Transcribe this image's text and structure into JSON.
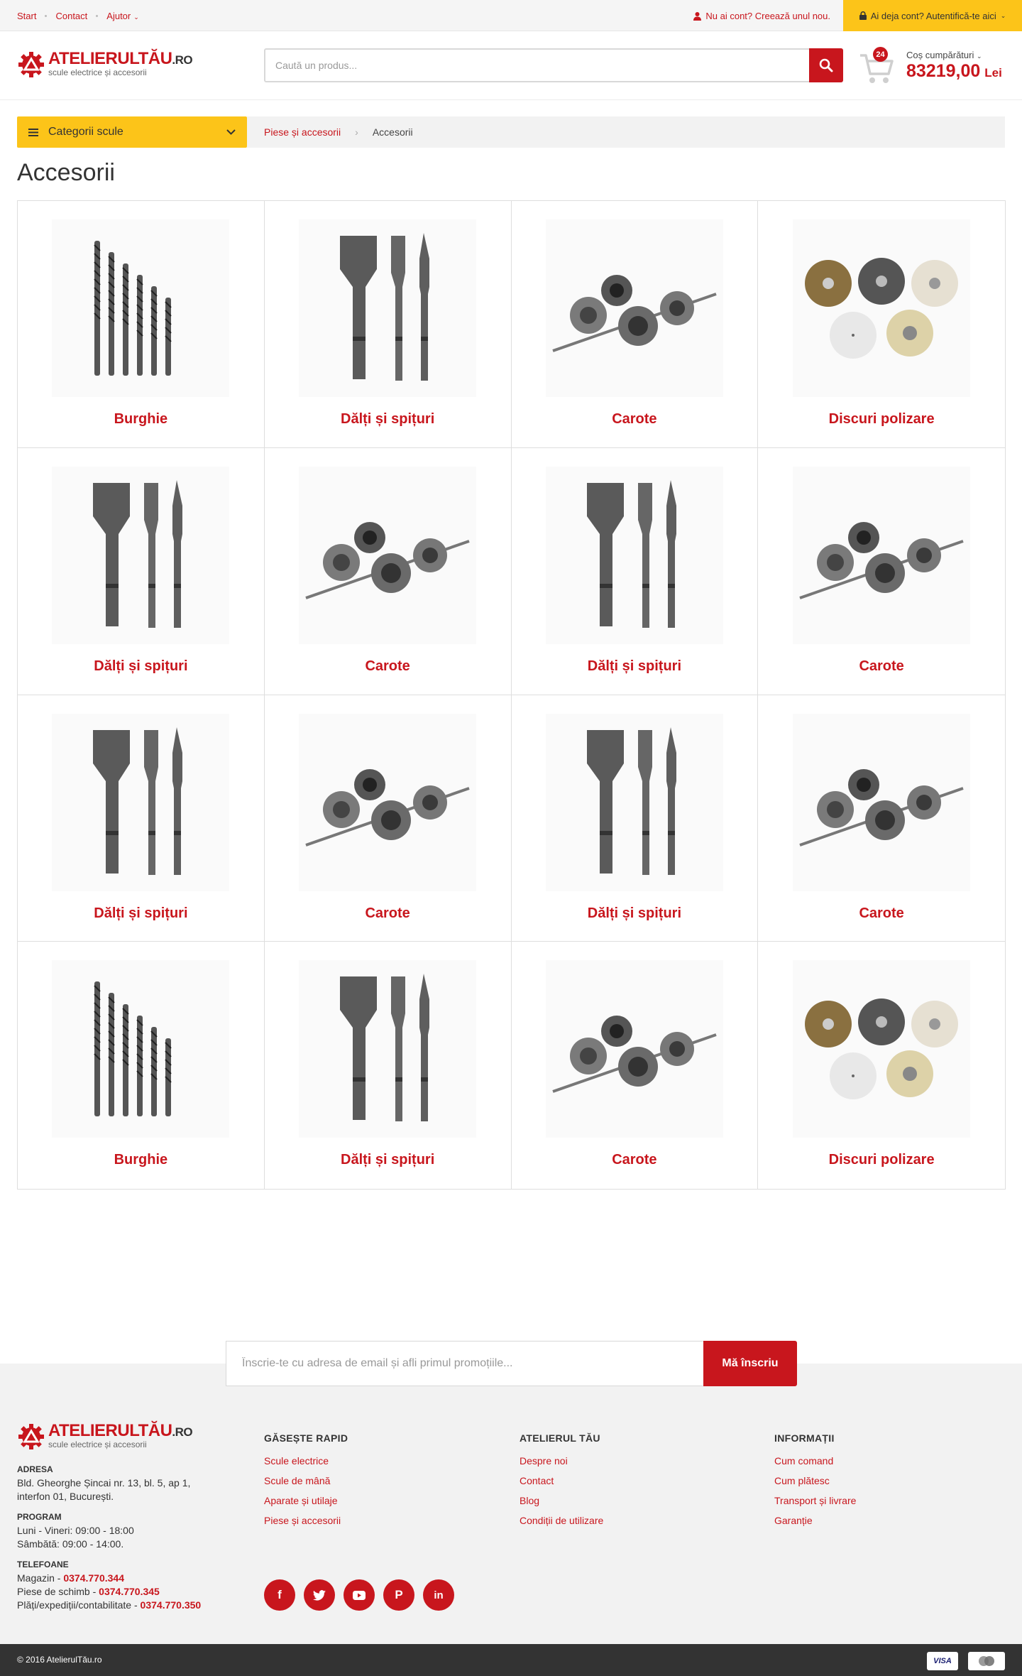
{
  "topbar": {
    "nav": [
      "Start",
      "Contact",
      "Ajutor"
    ],
    "register": "Nu ai cont? Creează unul nou.",
    "login": "Ai deja cont? Autentifică-te aici"
  },
  "brand": {
    "name": "ATELIERULTĂU",
    "domain": ".RO",
    "tagline": "scule electrice și accesorii"
  },
  "search": {
    "placeholder": "Caută un produs..."
  },
  "cart": {
    "count": "24",
    "label": "Coș cumpărături",
    "total": "83219,00",
    "currency": "Lei"
  },
  "categories_button": "Categorii scule",
  "breadcrumb": {
    "parent": "Piese și accesorii",
    "current": "Accesorii"
  },
  "page_title": "Accesorii",
  "products": [
    {
      "label": "Burghie",
      "icon": "drill-bits"
    },
    {
      "label": "Dălți și spițuri",
      "icon": "chisels"
    },
    {
      "label": "Carote",
      "icon": "core-bits"
    },
    {
      "label": "Discuri polizare",
      "icon": "grinding-discs"
    },
    {
      "label": "Dălți și spițuri",
      "icon": "chisels"
    },
    {
      "label": "Carote",
      "icon": "core-bits"
    },
    {
      "label": "Dălți și spițuri",
      "icon": "chisels"
    },
    {
      "label": "Carote",
      "icon": "core-bits"
    },
    {
      "label": "Dălți și spițuri",
      "icon": "chisels"
    },
    {
      "label": "Carote",
      "icon": "core-bits"
    },
    {
      "label": "Dălți și spițuri",
      "icon": "chisels"
    },
    {
      "label": "Carote",
      "icon": "core-bits"
    },
    {
      "label": "Burghie",
      "icon": "drill-bits"
    },
    {
      "label": "Dălți și spițuri",
      "icon": "chisels"
    },
    {
      "label": "Carote",
      "icon": "core-bits"
    },
    {
      "label": "Discuri polizare",
      "icon": "grinding-discs"
    }
  ],
  "newsletter": {
    "placeholder": "Înscrie-te cu adresa de email și afli primul promoțiile...",
    "button": "Mă înscriu"
  },
  "footer": {
    "address_label": "ADRESA",
    "address": [
      "Bld. Gheorghe Șincai nr. 13, bl. 5, ap 1,",
      "interfon 01, București."
    ],
    "program_label": "PROGRAM",
    "program": [
      "Luni - Vineri: 09:00 - 18:00",
      "Sâmbătă: 09:00 - 14:00."
    ],
    "phones_label": "TELEFOANE",
    "phones": [
      {
        "name": "Magazin - ",
        "number": "0374.770.344"
      },
      {
        "name": "Piese de schimb - ",
        "number": "0374.770.345"
      },
      {
        "name": "Plăți/expediții/contabilitate - ",
        "number": "0374.770.350"
      }
    ],
    "columns": [
      {
        "title": "GĂSEȘTE RAPID",
        "links": [
          "Scule electrice",
          "Scule de mână",
          "Aparate și utilaje",
          "Piese și accesorii"
        ]
      },
      {
        "title": "ATELIERUL TĂU",
        "links": [
          "Despre noi",
          "Contact",
          "Blog",
          "Condiții de utilizare"
        ]
      },
      {
        "title": "INFORMAȚII",
        "links": [
          "Cum comand",
          "Cum plătesc",
          "Transport și livrare",
          "Garanție"
        ]
      }
    ],
    "social": [
      "facebook-icon",
      "twitter-icon",
      "youtube-icon",
      "pinterest-icon",
      "linkedin-icon"
    ],
    "copyright": "© 2016 AtelierulTău.ro",
    "payments": [
      "VISA",
      "mastercard"
    ]
  },
  "colors": {
    "accent": "#c8161d",
    "yellow": "#fcc419",
    "dark": "#333333"
  }
}
